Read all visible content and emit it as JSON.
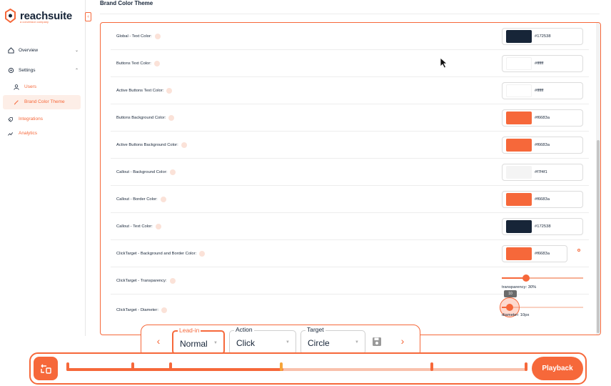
{
  "app": {
    "logo_text": "reachsuite",
    "logo_sub": "a conversion company",
    "brand_color": "#f6683a",
    "text_color": "#172538"
  },
  "sidebar": {
    "collapse_icon": "chevron-left-icon",
    "items": [
      {
        "label": "Overview",
        "icon": "home-icon",
        "chevron": "chevron-down-icon"
      },
      {
        "label": "Settings",
        "icon": "gear-icon",
        "chevron": "chevron-up-icon"
      },
      {
        "label": "Users",
        "icon": "user-icon"
      },
      {
        "label": "Brand Color Theme",
        "icon": "brush-icon",
        "active": true
      },
      {
        "label": "Integrations",
        "icon": "rocket-icon"
      },
      {
        "label": "Analytics",
        "icon": "trend-icon"
      }
    ]
  },
  "main": {
    "title": "Brand Color Theme",
    "rows": [
      {
        "label": "Global - Text Color:",
        "hex": "#172538",
        "swatch": "#172538"
      },
      {
        "label": "Buttons Text Color:",
        "hex": "#ffffff",
        "swatch": "#ffffff"
      },
      {
        "label": "Active Buttons Text Color:",
        "hex": "#ffffff",
        "swatch": "#ffffff"
      },
      {
        "label": "Buttons Background Color:",
        "hex": "#f6683a",
        "swatch": "#f6683a"
      },
      {
        "label": "Active Buttons Background Color:",
        "hex": "#f6683a",
        "swatch": "#f6683a"
      },
      {
        "label": "Callout - Background Color:",
        "hex": "#f7f4f1",
        "swatch": "#f4f4f4"
      },
      {
        "label": "Callout - Border Color:",
        "hex": "#f6683a",
        "swatch": "#f6683a"
      },
      {
        "label": "Callout - Text Color:",
        "hex": "#172538",
        "swatch": "#172538"
      },
      {
        "label": "ClickTarget - Background and Border Color:",
        "hex": "#f6683a",
        "swatch": "#f6683a"
      }
    ],
    "transparency": {
      "label": "ClickTarget - Transparency:",
      "caption": "transparency: 30%",
      "value": 30
    },
    "diameter": {
      "label": "ClickTarget - Diameter:",
      "caption": "diameter: 10px",
      "tooltip": "10",
      "value": 10
    }
  },
  "toolbar": {
    "prev_icon": "chevron-left-icon",
    "next_icon": "chevron-right-icon",
    "leadin": {
      "legend": "Lead-in",
      "value": "Normal"
    },
    "action": {
      "legend": "Action",
      "value": "Click"
    },
    "target": {
      "legend": "Target",
      "value": "Circle"
    },
    "save_icon": "save-icon"
  },
  "playback": {
    "layout_icon": "layout-switch-icon",
    "play_label": "Playback",
    "progress": 0.47
  }
}
